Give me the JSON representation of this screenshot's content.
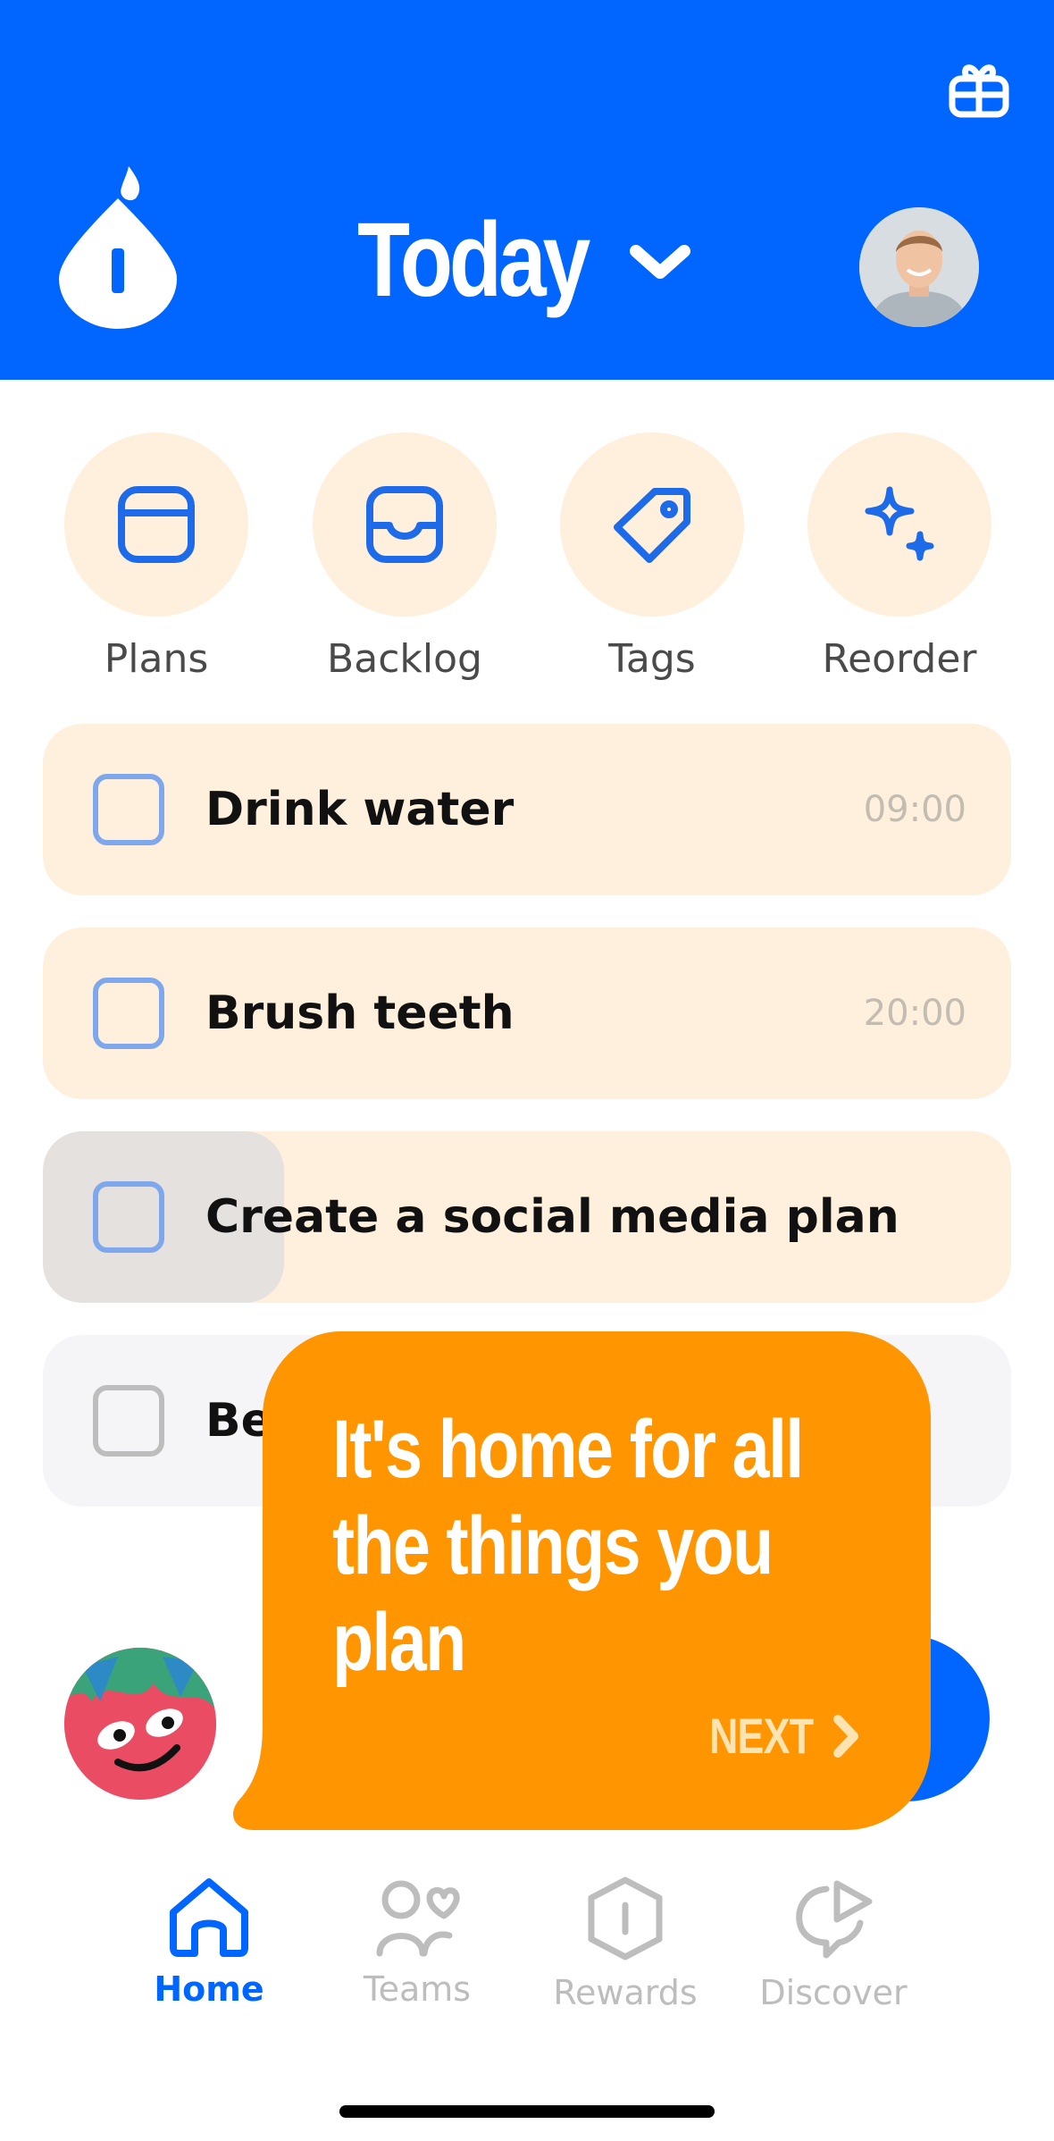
{
  "header": {
    "title": "Today",
    "background": "#0066FF",
    "icons": [
      "gift-icon",
      "logo-drop-icon",
      "chevron-down-icon"
    ]
  },
  "quick_actions": [
    {
      "label": "Plans",
      "icon": "calendar-icon"
    },
    {
      "label": "Backlog",
      "icon": "inbox-icon"
    },
    {
      "label": "Tags",
      "icon": "tag-icon"
    },
    {
      "label": "Reorder",
      "icon": "sparkles-icon"
    }
  ],
  "tasks": [
    {
      "title": "Drink water",
      "time": "09:00",
      "checked": false
    },
    {
      "title": "Brush teeth",
      "time": "20:00",
      "checked": false
    },
    {
      "title": "Create a social media plan",
      "time": "",
      "checked": false
    },
    {
      "title": "Be",
      "time": "",
      "checked": false
    }
  ],
  "tooltip": {
    "line1": "It's home for all",
    "line2": "the things you",
    "line3": "plan",
    "next_label": "NEXT",
    "color": "#FF9500"
  },
  "bottom_nav": [
    {
      "label": "Home",
      "icon": "home-icon",
      "active": true
    },
    {
      "label": "Teams",
      "icon": "teams-icon",
      "active": false
    },
    {
      "label": "Rewards",
      "icon": "rewards-icon",
      "active": false
    },
    {
      "label": "Discover",
      "icon": "discover-icon",
      "active": false
    }
  ],
  "colors": {
    "accent": "#0066FF",
    "card": "#FEF0DC",
    "tooltip": "#FF9500"
  }
}
